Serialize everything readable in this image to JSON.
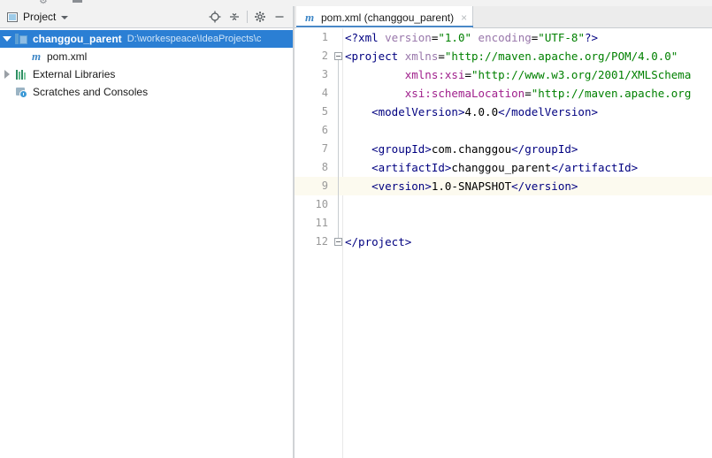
{
  "window": {
    "top_toolbar_glyphs": [
      "⚙",
      "■"
    ]
  },
  "project_panel": {
    "title": "Project",
    "title_icon": "project-window-icon",
    "dropdown_icon": "chevron-down-icon",
    "tools": [
      {
        "name": "locate-icon",
        "glyph": "⊕"
      },
      {
        "name": "collapse-all-icon",
        "glyph": "⩟"
      },
      {
        "name": "settings-gear-icon",
        "glyph": "⚙"
      },
      {
        "name": "hide-panel-icon",
        "glyph": "−"
      }
    ],
    "tree": [
      {
        "label": "changgou_parent",
        "path": "D:\\workespeace\\IdeaProjects\\c",
        "icon": "module-icon",
        "twisty": "expanded",
        "level": 1,
        "selected": true
      },
      {
        "label": "pom.xml",
        "path": "",
        "icon": "maven-file-icon",
        "twisty": "none",
        "level": 2,
        "selected": false
      },
      {
        "label": "External Libraries",
        "path": "",
        "icon": "library-icon",
        "twisty": "collapsed",
        "level": 1,
        "selected": false
      },
      {
        "label": "Scratches and Consoles",
        "path": "",
        "icon": "scratches-icon",
        "twisty": "none",
        "level": 1,
        "selected": false
      }
    ]
  },
  "editor": {
    "tab": {
      "icon": "maven-file-icon",
      "label": "pom.xml (changgou_parent)",
      "close_label": "×"
    },
    "current_line": 9,
    "lines": [
      {
        "no": "1",
        "fold": "none",
        "tokens": [
          {
            "cls": "x-tag",
            "t": "<?xml "
          },
          {
            "cls": "x-attr",
            "t": "version"
          },
          {
            "cls": "x-eq",
            "t": "="
          },
          {
            "cls": "x-str",
            "t": "\"1.0\""
          },
          {
            "cls": "x-text",
            "t": " "
          },
          {
            "cls": "x-attr",
            "t": "encoding"
          },
          {
            "cls": "x-eq",
            "t": "="
          },
          {
            "cls": "x-str",
            "t": "\"UTF-8\""
          },
          {
            "cls": "x-tag",
            "t": "?>"
          }
        ]
      },
      {
        "no": "2",
        "fold": "start",
        "tokens": [
          {
            "cls": "x-tag",
            "t": "<project "
          },
          {
            "cls": "x-attr",
            "t": "xmlns"
          },
          {
            "cls": "x-eq",
            "t": "="
          },
          {
            "cls": "x-str",
            "t": "\"http://maven.apache.org/POM/4.0.0\""
          }
        ]
      },
      {
        "no": "3",
        "fold": "mid",
        "tokens": [
          {
            "cls": "x-text",
            "t": "         "
          },
          {
            "cls": "x-attr2",
            "t": "xmlns:xsi"
          },
          {
            "cls": "x-eq",
            "t": "="
          },
          {
            "cls": "x-str",
            "t": "\"http://www.w3.org/2001/XMLSchema"
          }
        ]
      },
      {
        "no": "4",
        "fold": "mid",
        "tokens": [
          {
            "cls": "x-text",
            "t": "         "
          },
          {
            "cls": "x-attr2",
            "t": "xsi:schemaLocation"
          },
          {
            "cls": "x-eq",
            "t": "="
          },
          {
            "cls": "x-str",
            "t": "\"http://maven.apache.org"
          }
        ]
      },
      {
        "no": "5",
        "fold": "mid",
        "tokens": [
          {
            "cls": "x-text",
            "t": "    "
          },
          {
            "cls": "x-tag",
            "t": "<modelVersion>"
          },
          {
            "cls": "x-text",
            "t": "4.0.0"
          },
          {
            "cls": "x-tag",
            "t": "</modelVersion>"
          }
        ]
      },
      {
        "no": "6",
        "fold": "mid",
        "tokens": []
      },
      {
        "no": "7",
        "fold": "mid",
        "tokens": [
          {
            "cls": "x-text",
            "t": "    "
          },
          {
            "cls": "x-tag",
            "t": "<groupId>"
          },
          {
            "cls": "x-text",
            "t": "com.changgou"
          },
          {
            "cls": "x-tag",
            "t": "</groupId>"
          }
        ]
      },
      {
        "no": "8",
        "fold": "mid",
        "tokens": [
          {
            "cls": "x-text",
            "t": "    "
          },
          {
            "cls": "x-tag",
            "t": "<artifactId>"
          },
          {
            "cls": "x-text",
            "t": "changgou_parent"
          },
          {
            "cls": "x-tag",
            "t": "</artifactId>"
          }
        ]
      },
      {
        "no": "9",
        "fold": "mid",
        "tokens": [
          {
            "cls": "x-text",
            "t": "    "
          },
          {
            "cls": "x-tag",
            "t": "<version>"
          },
          {
            "cls": "x-text",
            "t": "1.0-SNAPSHOT"
          },
          {
            "cls": "x-tag",
            "t": "</version>"
          }
        ]
      },
      {
        "no": "10",
        "fold": "mid",
        "tokens": []
      },
      {
        "no": "11",
        "fold": "mid",
        "tokens": []
      },
      {
        "no": "12",
        "fold": "end",
        "tokens": [
          {
            "cls": "x-tag",
            "t": "</project>"
          }
        ]
      }
    ]
  },
  "colors": {
    "selection_blue": "#2b7fd4",
    "tab_underline": "#4a88c7",
    "xml_tag": "#000080",
    "xml_attr": "#9876aa",
    "xml_attr_ns": "#a0208c",
    "xml_string": "#008000",
    "current_line_bg": "#fcfaef",
    "panel_header_bg": "#f2f2f2"
  }
}
